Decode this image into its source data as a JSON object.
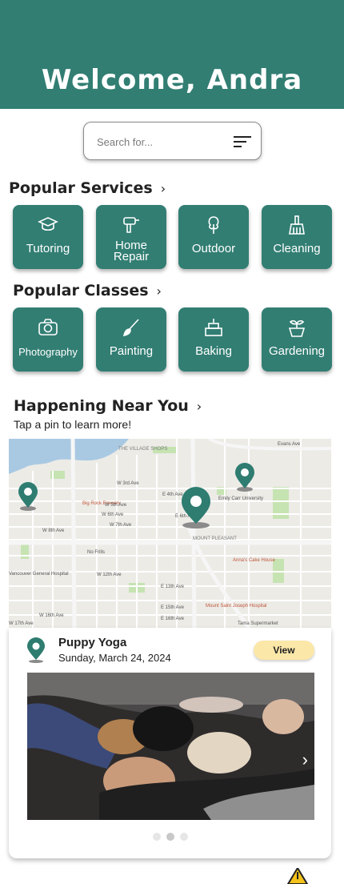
{
  "header": {
    "title": "Welcome, Andra",
    "bg_color": "#327e73"
  },
  "search": {
    "placeholder": "Search for...",
    "filter_icon": "filter-lines-icon"
  },
  "popular_services": {
    "title": "Popular Services",
    "items": [
      {
        "label": "Tutoring",
        "icon": "graduation-cap-icon"
      },
      {
        "label": "Home Repair",
        "line1": "Home",
        "line2": "Repair",
        "icon": "drill-icon"
      },
      {
        "label": "Outdoor",
        "icon": "tree-icon"
      },
      {
        "label": "Cleaning",
        "icon": "broom-icon"
      }
    ]
  },
  "popular_classes": {
    "title": "Popular Classes",
    "items": [
      {
        "label": "Photography",
        "icon": "camera-icon"
      },
      {
        "label": "Painting",
        "icon": "paintbrush-icon"
      },
      {
        "label": "Baking",
        "icon": "cake-icon"
      },
      {
        "label": "Gardening",
        "icon": "sprout-icon"
      }
    ]
  },
  "near_you": {
    "title": "Happening Near You",
    "subtitle": "Tap a pin to learn more!",
    "map_labels": {
      "village_shops": "THE VILLAGE SHOPS",
      "big_rock": "Big Rock Brewery",
      "emily_carr": "Emily Carr University",
      "mount_pleasant": "MOUNT PLEASANT",
      "annas": "Anna's Cake House",
      "no_frills": "No Frills",
      "vgh": "Vancouver General Hospital",
      "mount_saint_joseph": "Mount Saint Joseph Hospital",
      "tama": "Tama Supermarket",
      "w3rd": "W 3rd Ave",
      "w5th": "W 5th Ave",
      "w6th": "W 6th Ave",
      "w7th": "W 7th Ave",
      "w8th": "W 8th Ave",
      "w12th": "W 12th Ave",
      "w16th": "W 16th Ave",
      "w17th": "W 17th Ave",
      "e4th": "E 4th Ave",
      "e6th": "E 6th Ave",
      "e13th": "E 13th Ave",
      "e15th": "E 15th Ave",
      "e16th": "E 16th Ave",
      "evans": "Evans Ave"
    }
  },
  "event": {
    "title": "Puppy Yoga",
    "date": "Sunday, March 24, 2024",
    "button": "View",
    "carousel_index": 1,
    "carousel_count": 3
  }
}
